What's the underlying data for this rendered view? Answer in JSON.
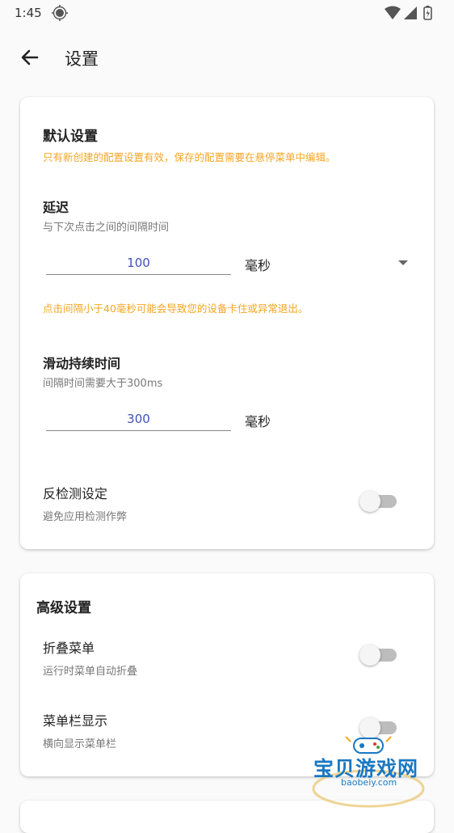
{
  "status_bar": {
    "time": "1:45"
  },
  "app_bar": {
    "title": "设置"
  },
  "default_settings": {
    "title": "默认设置",
    "note": "只有新创建的配置设置有效，保存的配置需要在悬停菜单中编辑。",
    "delay": {
      "label": "延迟",
      "desc": "与下次点击之间的间隔时间",
      "value": "100",
      "unit": "毫秒",
      "warning": "点击间隔小于40毫秒可能会导致您的设备卡住或异常退出。"
    },
    "swipe": {
      "label": "滑动持续时间",
      "desc": "间隔时间需要大于300ms",
      "value": "300",
      "unit": "毫秒"
    },
    "anti_detect": {
      "label": "反检测设定",
      "desc": "避免应用检测作弊",
      "enabled": false
    }
  },
  "advanced_settings": {
    "title": "高级设置",
    "collapse_menu": {
      "label": "折叠菜单",
      "desc": "运行时菜单自动折叠",
      "enabled": false
    },
    "menu_bar": {
      "label": "菜单栏显示",
      "desc": "横向显示菜单栏",
      "enabled": false
    }
  },
  "watermark": {
    "text": "宝贝游戏网",
    "url": "baobeiy.com"
  },
  "colors": {
    "accent": "#3f51b5",
    "warning": "#f5a623",
    "watermark": "#1a78c2"
  }
}
